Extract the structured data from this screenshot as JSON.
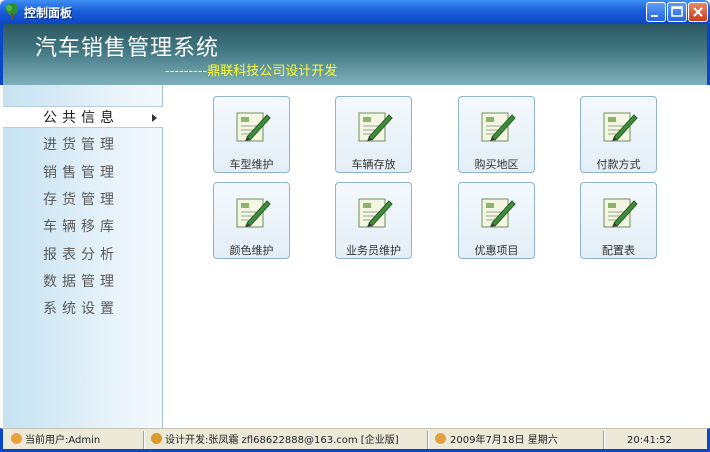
{
  "window": {
    "title": "控制面板"
  },
  "header": {
    "title": "汽车销售管理系统",
    "subtitle": "---------鼎联科技公司设计开发"
  },
  "sidebar": {
    "items": [
      {
        "label": "公共信息",
        "active": true
      },
      {
        "label": "进货管理",
        "active": false
      },
      {
        "label": "销售管理",
        "active": false
      },
      {
        "label": "存货管理",
        "active": false
      },
      {
        "label": "车辆移库",
        "active": false
      },
      {
        "label": "报表分析",
        "active": false
      },
      {
        "label": "数据管理",
        "active": false
      },
      {
        "label": "系统设置",
        "active": false
      }
    ]
  },
  "main": {
    "tiles": [
      {
        "label": "车型维护",
        "icon": "document-edit-icon"
      },
      {
        "label": "车辆存放",
        "icon": "document-edit-icon"
      },
      {
        "label": "购买地区",
        "icon": "document-edit-icon"
      },
      {
        "label": "付款方式",
        "icon": "document-edit-icon"
      },
      {
        "label": "颜色维护",
        "icon": "document-edit-icon"
      },
      {
        "label": "业务员维护",
        "icon": "document-edit-icon"
      },
      {
        "label": "优惠项目",
        "icon": "document-edit-icon"
      },
      {
        "label": "配置表",
        "icon": "document-edit-icon"
      }
    ]
  },
  "statusbar": {
    "user": "当前用户:Admin",
    "developer": "设计开发:张凤霜  zfl68622888@163.com  [企业版]",
    "date": "2009年7月18日  星期六",
    "time": "20:41:52"
  },
  "colors": {
    "titlebar": "#1c5fd9",
    "header": "#3f7580",
    "subtitle": "#ffff33",
    "sidebar": "#c5e2f1",
    "statusbar": "#ece9d8"
  }
}
